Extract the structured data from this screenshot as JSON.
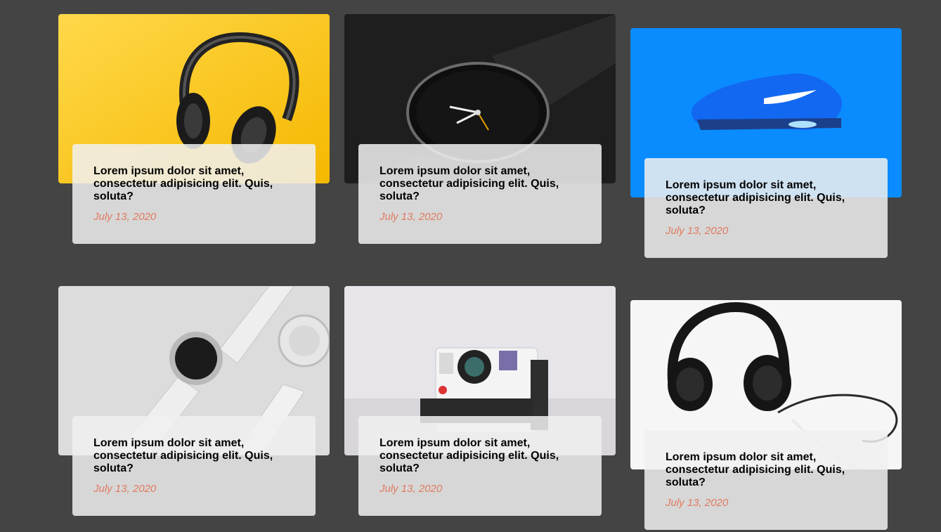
{
  "cards": [
    {
      "image": "yellow-headphones-photo",
      "title": "Lorem ipsum dolor sit amet, consectetur adipisicing elit. Quis, soluta?",
      "date": "July 13, 2020"
    },
    {
      "image": "black-watch-photo",
      "title": "Lorem ipsum dolor sit amet, consectetur adipisicing elit. Quis, soluta?",
      "date": "July 13, 2020"
    },
    {
      "image": "blue-sneaker-photo",
      "title": "Lorem ipsum dolor sit amet, consectetur adipisicing elit. Quis, soluta?",
      "date": "July 13, 2020"
    },
    {
      "image": "white-smartwatch-photo",
      "title": "Lorem ipsum dolor sit amet, consectetur adipisicing elit. Quis, soluta?",
      "date": "July 13, 2020"
    },
    {
      "image": "instant-camera-photo",
      "title": "Lorem ipsum dolor sit amet, consectetur adipisicing elit. Quis, soluta?",
      "date": "July 13, 2020"
    },
    {
      "image": "black-headphones-photo",
      "title": "Lorem ipsum dolor sit amet, consectetur adipisicing elit. Quis, soluta?",
      "date": "July 13, 2020"
    }
  ],
  "colors": {
    "page_background": "#444444",
    "date_text": "#e07a5f",
    "caption_background": "#f0f0f0"
  }
}
